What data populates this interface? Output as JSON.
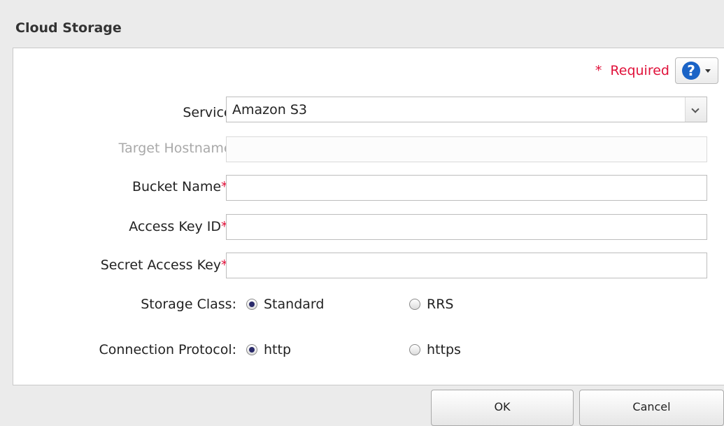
{
  "dialog": {
    "title": "Cloud Storage",
    "required_label": "Required",
    "required_star": "*",
    "help_icon": "question-circle-icon"
  },
  "form": {
    "service": {
      "label": "Service:",
      "value": "Amazon S3"
    },
    "target_hostname": {
      "label": "Target Hostname:",
      "value": ""
    },
    "bucket_name": {
      "label": "Bucket Name",
      "suffix": ":",
      "value": ""
    },
    "access_key_id": {
      "label": "Access Key ID",
      "suffix": ":",
      "value": ""
    },
    "secret_access_key": {
      "label": "Secret Access Key",
      "suffix": ":",
      "value": ""
    },
    "storage_class": {
      "label": "Storage Class:",
      "options": [
        "Standard",
        "RRS"
      ],
      "selected": "Standard"
    },
    "connection_protocol": {
      "label": "Connection Protocol:",
      "options": [
        "http",
        "https"
      ],
      "selected": "http"
    }
  },
  "buttons": {
    "ok": "OK",
    "cancel": "Cancel"
  },
  "colors": {
    "required": "#e0113a",
    "help_blue": "#1a63c6"
  }
}
